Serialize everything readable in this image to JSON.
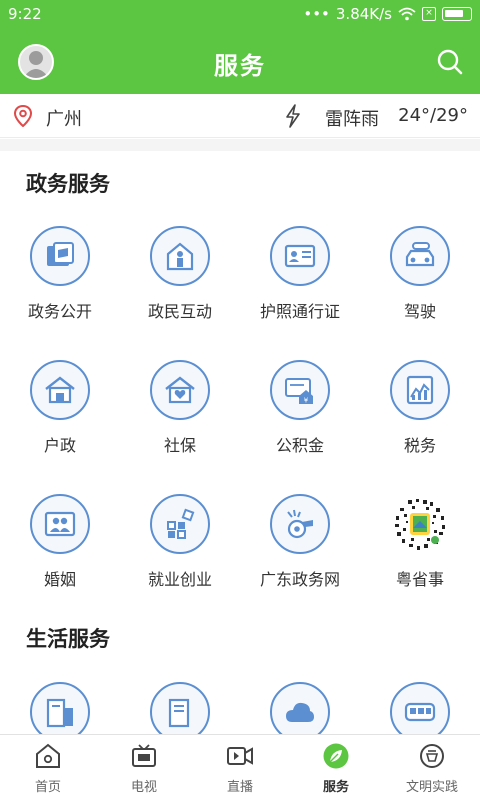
{
  "status_bar": {
    "time": "9:22",
    "network_speed": "3.84K/s",
    "dots": "•••"
  },
  "header": {
    "title": "服务",
    "avatar_icon": "avatar-icon",
    "search_icon": "search-icon"
  },
  "weather": {
    "city": "广州",
    "condition": "雷阵雨",
    "temperature": "24°/29°"
  },
  "sections": {
    "gov": {
      "title": "政务服务",
      "items": [
        {
          "label": "政务公开",
          "icon": "open-government-icon"
        },
        {
          "label": "政民互动",
          "icon": "interaction-icon"
        },
        {
          "label": "护照通行证",
          "icon": "passport-icon"
        },
        {
          "label": "驾驶",
          "icon": "car-icon"
        },
        {
          "label": "户政",
          "icon": "house-icon"
        },
        {
          "label": "社保",
          "icon": "social-security-icon"
        },
        {
          "label": "公积金",
          "icon": "housing-fund-icon"
        },
        {
          "label": "税务",
          "icon": "tax-icon"
        },
        {
          "label": "婚姻",
          "icon": "marriage-icon"
        },
        {
          "label": "就业创业",
          "icon": "employment-icon"
        },
        {
          "label": "广东政务网",
          "icon": "whistle-icon"
        },
        {
          "label": "粤省事",
          "icon": "qr-code-icon"
        }
      ]
    },
    "life": {
      "title": "生活服务",
      "items": [
        {
          "label": "",
          "icon": "building-icon"
        },
        {
          "label": "",
          "icon": "building-icon"
        },
        {
          "label": "",
          "icon": "cloud-icon"
        },
        {
          "label": "",
          "icon": "bus-icon"
        }
      ]
    }
  },
  "tabs": [
    {
      "label": "首页",
      "icon": "home-icon"
    },
    {
      "label": "电视",
      "icon": "tv-icon"
    },
    {
      "label": "直播",
      "icon": "live-video-icon"
    },
    {
      "label": "服务",
      "icon": "service-leaf-icon",
      "active": true
    },
    {
      "label": "文明实践",
      "icon": "civilization-icon"
    }
  ],
  "colors": {
    "brand_green": "#5cc541",
    "icon_blue": "#5b8fd1"
  }
}
